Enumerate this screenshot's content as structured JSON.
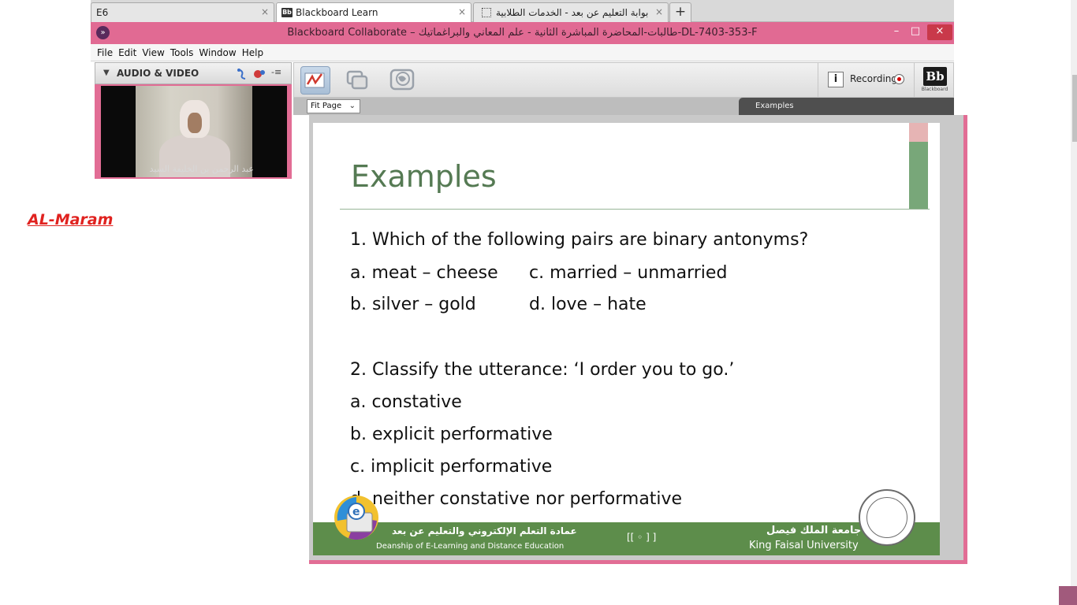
{
  "browser": {
    "tabs": [
      {
        "label": "E6"
      },
      {
        "label": "Blackboard Learn",
        "favicon": "Bb"
      },
      {
        "label": "بوابة التعليم عن بعد - الخدمات الطلابية"
      }
    ],
    "new_tab": "+",
    "close_glyph": "×"
  },
  "window": {
    "title": "Blackboard Collaborate – طالبات-المحاضرة المباشرة الثانية - علم المعاني والبراغماتيك-DL-7403-353-F",
    "minimize": "–",
    "maximize": "□",
    "close": "×"
  },
  "menu": [
    "File",
    "Edit",
    "View",
    "Tools",
    "Window",
    "Help"
  ],
  "av_panel": {
    "title": "AUDIO & VIDEO",
    "caret": "▼",
    "video_caption": "عبد الرحمن بن الخليفة السيد"
  },
  "toolbar": {
    "recording_label": "Recording",
    "info": "i",
    "logo": "Bb",
    "logo_caption": "Blackboard",
    "fit_page": "Fit Page",
    "fit_page_chevron": "⌄",
    "page_title": "Examples"
  },
  "slide": {
    "heading": "Examples",
    "q1": "1. Which of the following pairs are binary antonyms?",
    "q1_a": "a. meat – cheese",
    "q1_c": "c. married – unmarried",
    "q1_b": "b. silver – gold",
    "q1_d": "d. love – hate",
    "q2": "2. Classify the utterance: ‘I order you to go.’",
    "q2_a": "a. constative",
    "q2_b": "b. explicit performative",
    "q2_c": "c. implicit performative",
    "q2_d": "d. neither constative nor performative",
    "footer": {
      "deanship_ar": "عمادة التعلم الإلكتروني والتعليم عن بعد",
      "deanship_en": "Deanship of E-Learning and Distance Education",
      "page_marker": "[[ ◦ ] ]",
      "university_ar": "جامعة الملك فيصل",
      "university_en": "King Faisal University"
    }
  },
  "overlay_label": "AL-Maram",
  "colors": {
    "collaborate_pink": "#e16a93",
    "slide_green": "#5d8d4b",
    "heading_green": "#557a53",
    "label_red": "#e0221f"
  }
}
